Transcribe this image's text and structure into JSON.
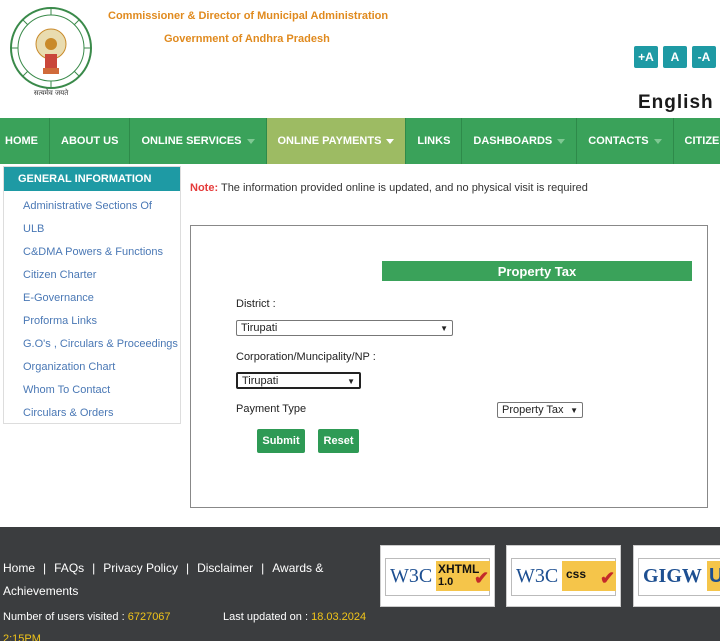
{
  "header": {
    "org_title": "Commissioner & Director of Municipal Administration",
    "org_subtitle": "Government of Andhra Pradesh",
    "emblem_text": "सत्यमेव जयते",
    "font_buttons": [
      "+A",
      "A",
      "-A"
    ],
    "language": "English"
  },
  "nav": {
    "items": [
      {
        "label": "HOME",
        "dropdown": false
      },
      {
        "label": "ABOUT US",
        "dropdown": false
      },
      {
        "label": "ONLINE SERVICES",
        "dropdown": true
      },
      {
        "label": "ONLINE PAYMENTS",
        "dropdown": true,
        "active": true
      },
      {
        "label": "LINKS",
        "dropdown": false
      },
      {
        "label": "DASHBOARDS",
        "dropdown": true
      },
      {
        "label": "CONTACTS",
        "dropdown": true
      },
      {
        "label": "CITIZEN L",
        "dropdown": false
      }
    ]
  },
  "sidebar": {
    "heading": "GENERAL INFORMATION",
    "items": [
      "Administrative Sections Of",
      "ULB",
      "C&DMA Powers & Functions",
      "Citizen Charter",
      "E-Governance",
      "Proforma Links",
      "G.O's , Circulars & Proceedings",
      "Organization Chart",
      "Whom To Contact",
      "Circulars & Orders"
    ]
  },
  "note": {
    "label": "Note:",
    "text": "The information provided online is updated, and no physical visit is required"
  },
  "form": {
    "title": "Property Tax",
    "district_label": "District :",
    "district_value": "Tirupati",
    "corp_label": "Corporation/Muncipality/NP :",
    "corp_value": "Tirupati",
    "payment_label": "Payment Type",
    "payment_value": "Property Tax",
    "submit": "Submit",
    "reset": "Reset"
  },
  "footer": {
    "links": [
      "Home",
      "FAQs",
      "Privacy Policy",
      "Disclaimer",
      "Awards &",
      "Achievements"
    ],
    "visits_label": "Number of users visited :",
    "visits_value": "6727067",
    "updated_label": "Last updated on :",
    "updated_value": "18.03.2024",
    "updated_time": "2:15PM",
    "badges": [
      {
        "brand": "W3C",
        "text": "XHTML",
        "version": "1.0"
      },
      {
        "brand": "W3C",
        "text": "css"
      },
      {
        "brand": "GIGW",
        "text": "U"
      }
    ]
  },
  "colors": {
    "nav_green": "#3aa25a",
    "nav_active": "#9dbb63",
    "teal": "#1e9aa4",
    "orange_title": "#e08a1e",
    "footer_bg": "#3b3d3f",
    "footer_highlight": "#f0c419",
    "note_red": "#e53b3b"
  }
}
